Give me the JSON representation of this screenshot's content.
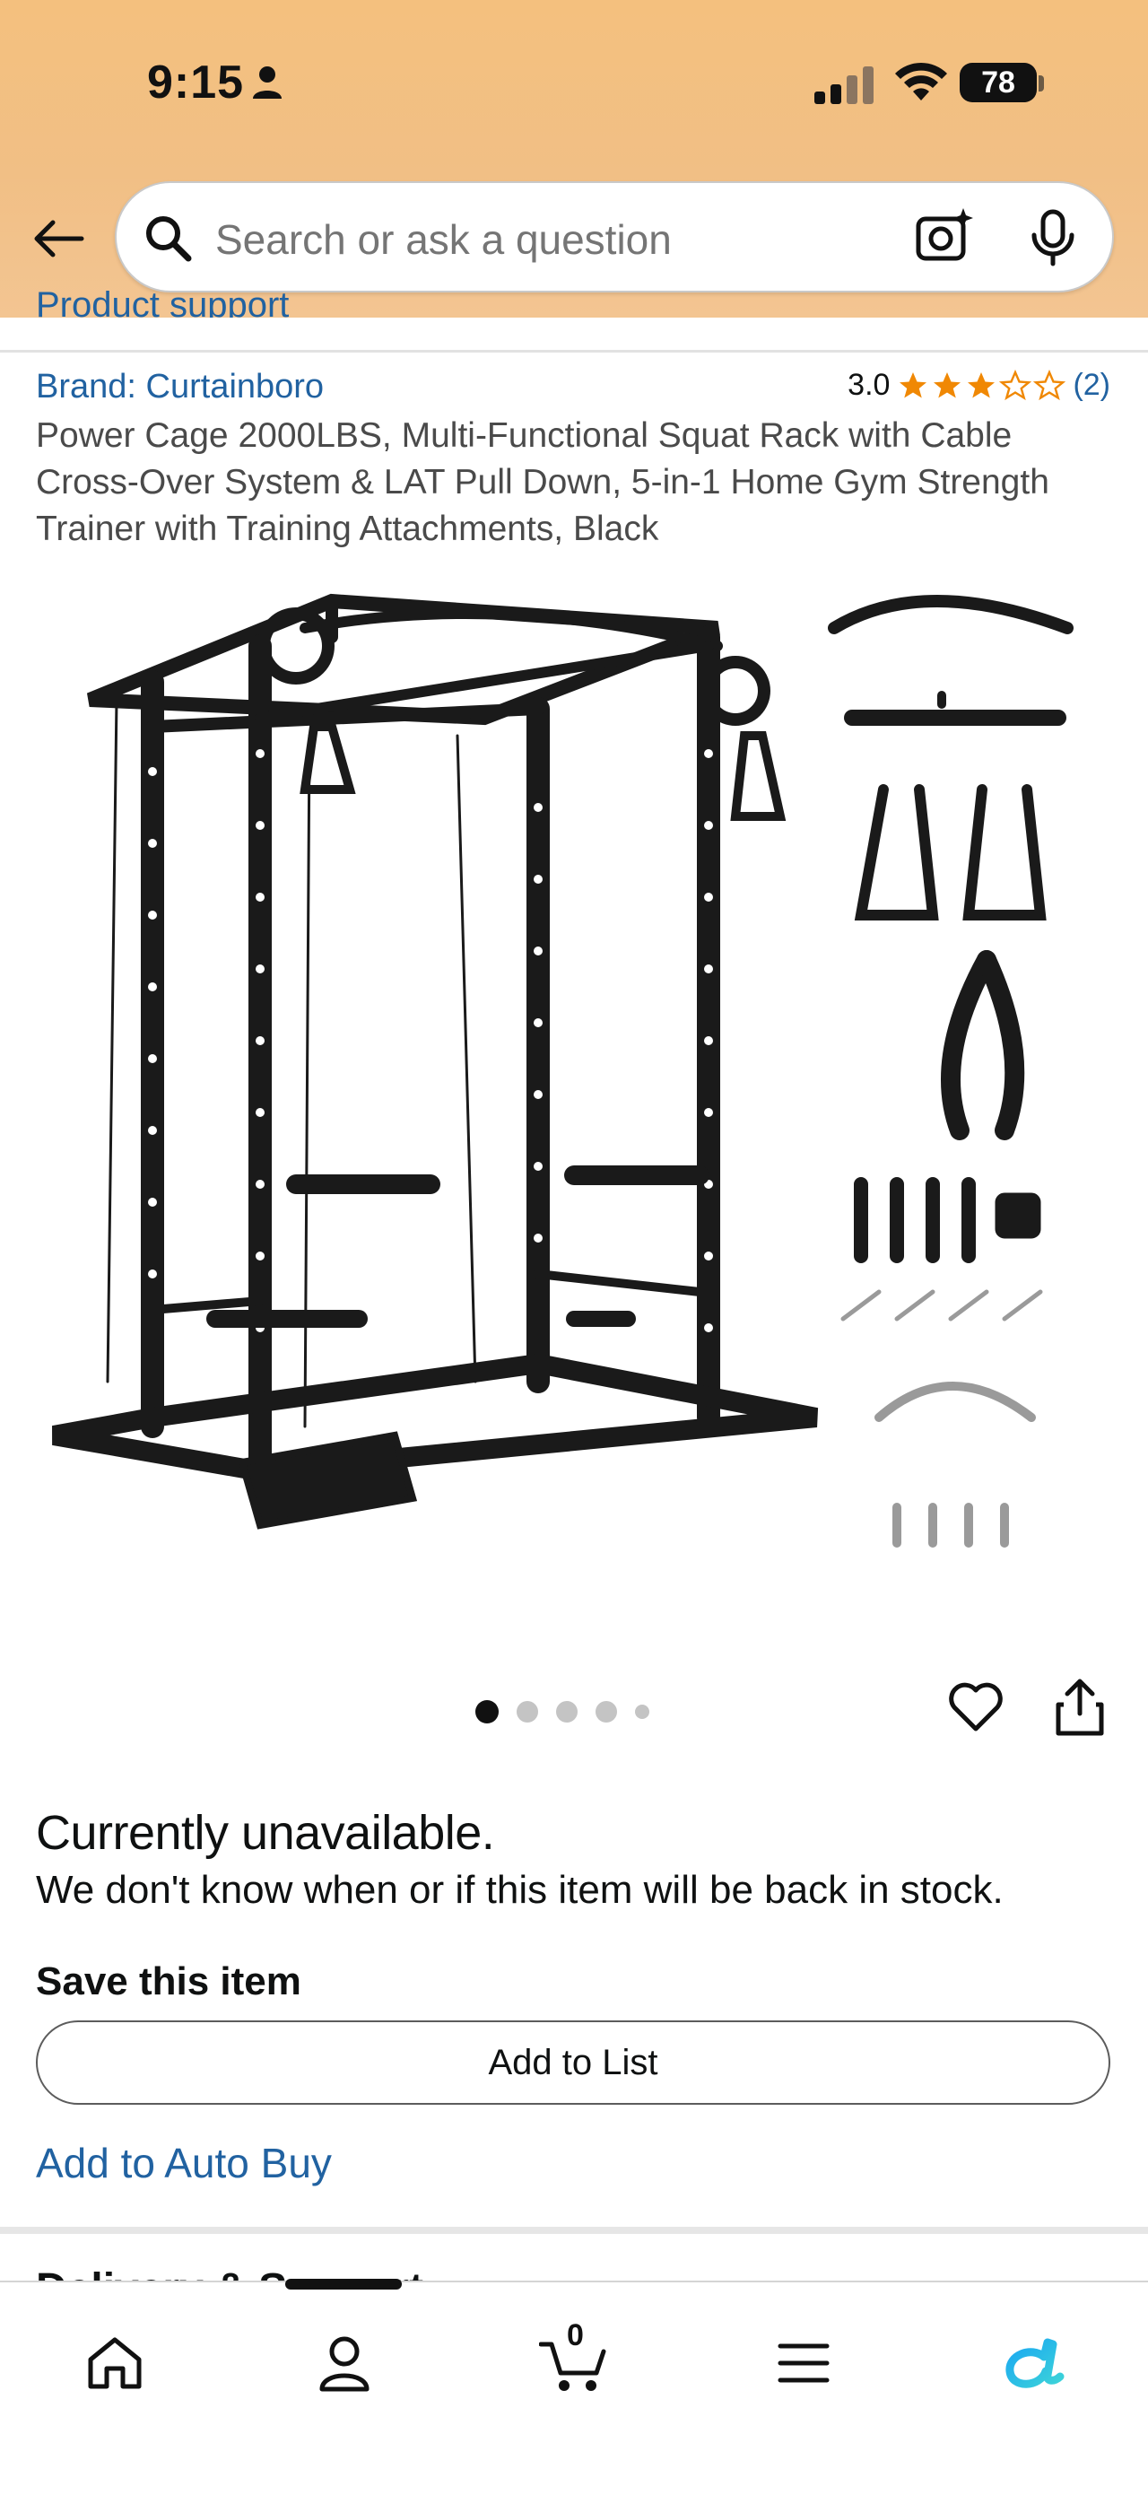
{
  "status_bar": {
    "time": "9:15",
    "battery": "78"
  },
  "search": {
    "placeholder": "Search or ask a question"
  },
  "partial_link": "Product support",
  "product": {
    "brand": "Brand: Curtainboro",
    "rating_value": "3.0",
    "rating_stars": 3,
    "rating_count": "(2)",
    "title": "Power Cage 2000LBS, Multi-Functional Squat Rack with Cable Cross-Over System & LAT Pull Down, 5-in-1 Home Gym Strength Trainer with Training Attachments, Black",
    "image_count": 5,
    "image_active_index": 0
  },
  "availability": {
    "title": "Currently unavailable.",
    "message": "We don't know when or if this item will be back in stock."
  },
  "save_section": {
    "heading": "Save this item",
    "add_to_list_label": "Add to List",
    "auto_buy_label": "Add to Auto Buy"
  },
  "next_section_peek": "Delivery & Support",
  "bottom_nav": {
    "items": [
      "home-icon",
      "profile-icon",
      "cart-icon",
      "menu-icon",
      "rufus-icon"
    ],
    "cart_count": "0"
  },
  "colors": {
    "header_bg": "#f2c086",
    "link": "#2162a1",
    "star": "#f08804"
  }
}
